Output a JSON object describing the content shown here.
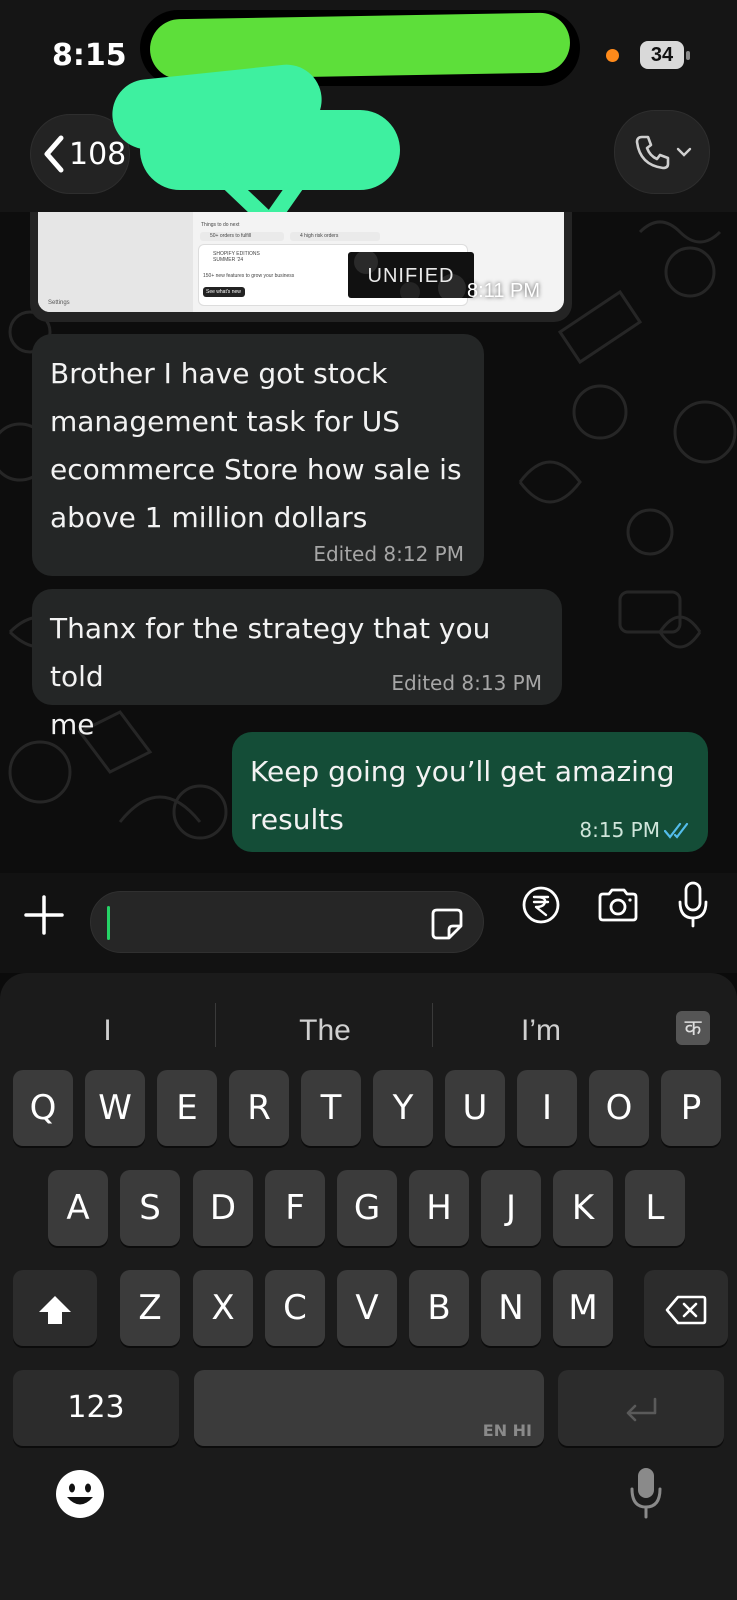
{
  "status_bar": {
    "time": "8:15",
    "battery": "34"
  },
  "header": {
    "back_count": "108"
  },
  "image_message": {
    "caption_tile": "UNIFIED",
    "time": "8:11 PM",
    "thumb": {
      "things_to_do": "Things to do next",
      "orders_fulfill": "50+ orders to fulfill",
      "risk_orders": "4 high risk orders",
      "editions_title": "SHOPIFY EDITIONS SUMMER '24",
      "editions_sub": "150+ new features to grow your business",
      "editions_btn": "See what's new",
      "settings": "Settings"
    }
  },
  "messages": [
    {
      "direction": "incoming",
      "lines": [
        "Brother I have got stock",
        "management task for US",
        "ecommerce Store how sale is",
        "above 1 million dollars"
      ],
      "meta": "Edited 8:12 PM"
    },
    {
      "direction": "incoming",
      "lines": [
        "Thanx for the strategy that you told",
        "me"
      ],
      "meta": "Edited 8:13 PM"
    },
    {
      "direction": "outgoing",
      "lines": [
        "Keep going you’ll get amazing",
        "results"
      ],
      "meta": "8:15 PM",
      "read_status": "double-check-read"
    }
  ],
  "composer": {
    "input_value": ""
  },
  "keyboard": {
    "suggestions": [
      "I",
      "The",
      "I’m"
    ],
    "hindi_toggle": "क",
    "row1": [
      "Q",
      "W",
      "E",
      "R",
      "T",
      "Y",
      "U",
      "I",
      "O",
      "P"
    ],
    "row2": [
      "A",
      "S",
      "D",
      "F",
      "G",
      "H",
      "J",
      "K",
      "L"
    ],
    "row3": [
      "Z",
      "X",
      "C",
      "V",
      "B",
      "N",
      "M"
    ],
    "numbers_key": "123",
    "space_lang": "EN HI",
    "space_value": ""
  },
  "colors": {
    "outgoing_bubble": "#144d37",
    "incoming_bubble": "#242626",
    "accent_green": "#25d366",
    "read_tick": "#53bdeb",
    "redaction_green": "#5ddf3a",
    "redaction_mint": "#3ef0a0"
  },
  "icons": [
    "back-chevron-icon",
    "phone-icon",
    "chevron-down-icon",
    "plus-icon",
    "sticker-icon",
    "rupee-icon",
    "camera-icon",
    "microphone-icon",
    "shift-icon",
    "backspace-icon",
    "return-icon",
    "emoji-icon",
    "dictation-mic-icon",
    "double-check-icon"
  ]
}
